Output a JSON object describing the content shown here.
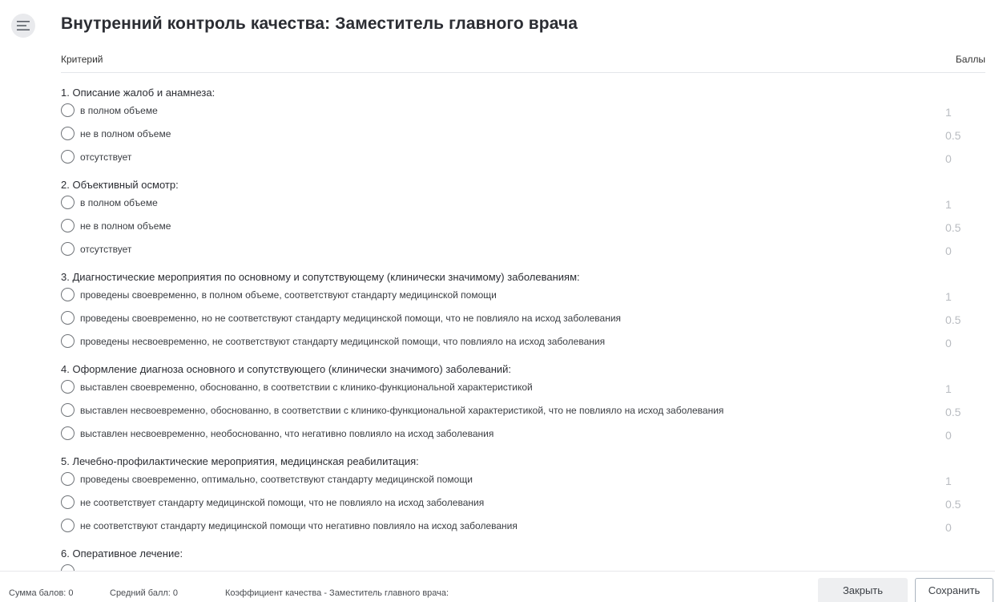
{
  "header": {
    "title": "Внутренний контроль качества: Заместитель главного врача",
    "col_criterion": "Критерий",
    "col_score": "Баллы"
  },
  "sections": [
    {
      "title": "1. Описание жалоб и анамнеза:",
      "options": [
        {
          "label": "в полном объеме",
          "score": "1"
        },
        {
          "label": "не в полном объеме",
          "score": "0.5"
        },
        {
          "label": "отсутствует",
          "score": "0"
        }
      ]
    },
    {
      "title": "2. Объективный осмотр:",
      "options": [
        {
          "label": "в полном объеме",
          "score": "1"
        },
        {
          "label": "не в полном объеме",
          "score": "0.5"
        },
        {
          "label": "отсутствует",
          "score": "0"
        }
      ]
    },
    {
      "title": "3. Диагностические мероприятия по основному и сопутствующему (клинически значимому) заболеваниям:",
      "options": [
        {
          "label": "проведены своевременно, в полном объеме, соответствуют стандарту медицинской помощи",
          "score": "1"
        },
        {
          "label": "проведены своевременно, но не соответствуют стандарту медицинской помощи, что не повлияло на исход заболевания",
          "score": "0.5"
        },
        {
          "label": "проведены несвоевременно, не соответствуют стандарту медицинской помощи, что повлияло на исход заболевания",
          "score": "0"
        }
      ]
    },
    {
      "title": "4. Оформление диагноза основного и сопутствующего (клинически значимого) заболеваний:",
      "options": [
        {
          "label": "выставлен своевременно, обоснованно, в соответствии с клинико-функциональной характеристикой",
          "score": "1"
        },
        {
          "label": "выставлен несвоевременно, обоснованно, в соответствии с клинико-функциональной характеристикой, что не повлияло на исход заболевания",
          "score": "0.5"
        },
        {
          "label": "выставлен несвоевременно, необоснованно, что негативно повлияло на исход заболевания",
          "score": "0"
        }
      ]
    },
    {
      "title": "5. Лечебно-профилактические мероприятия, медицинская реабилитация:",
      "options": [
        {
          "label": "проведены своевременно, оптимально, соответствуют стандарту медицинской помощи",
          "score": "1"
        },
        {
          "label": "не соответствует стандарту медицинской помощи, что не повлияло на исход заболевания",
          "score": "0.5"
        },
        {
          "label": "не соответствуют стандарту медицинской помощи что негативно повлияло на исход заболевания",
          "score": "0"
        }
      ]
    },
    {
      "title": "6. Оперативное лечение:",
      "options": [
        {
          "label": "",
          "score": ""
        }
      ]
    }
  ],
  "footer": {
    "sum_label": "Сумма балов: 0",
    "avg_label": "Средний балл: 0",
    "coef_label": "Коэффициент качества - Заместитель главного врача:",
    "close_button": "Закрыть",
    "save_button": "Сохранить"
  },
  "icons": {
    "menu": "hamburger-menu-icon",
    "radio": "radio-unchecked-icon"
  },
  "colors": {
    "menu_bg": "#e9eaed",
    "score_text": "#b9bcc1",
    "save_border": "#aab4bf"
  }
}
